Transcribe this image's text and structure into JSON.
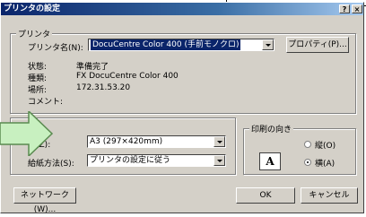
{
  "window": {
    "title": "プリンタの設定",
    "help_btn": "?",
    "close_btn": "×"
  },
  "printer_group": {
    "label": "プリンタ",
    "name_label": "プリンタ名(N):",
    "name_value": "DocuCentre Color 400 (手前モノクロ)",
    "properties_btn": "プロパティ(P)...",
    "status_label": "状態:",
    "status_value": "準備完了",
    "type_label": "種類:",
    "type_value": "FX DocuCentre Color 400",
    "location_label": "場所:",
    "location_value": "172.31.53.20",
    "comment_label": "コメント:",
    "comment_value": ""
  },
  "paper": {
    "size_label": "ズ(Z):",
    "size_value": "A3 (297×420mm)",
    "feed_label": "給紙方法(S):",
    "feed_value": "プリンタの設定に従う"
  },
  "orientation": {
    "label": "印刷の向き",
    "icon_letter": "A",
    "portrait": "縦(O)",
    "landscape": "横(A)",
    "selected": "landscape"
  },
  "buttons": {
    "network": "ネットワーク(W)...",
    "ok": "OK",
    "cancel": "キャンセル"
  },
  "colors": {
    "arrow_fill": "#c8f0c0",
    "arrow_stroke": "#5a8a50",
    "titlebar": "#0a246a"
  }
}
